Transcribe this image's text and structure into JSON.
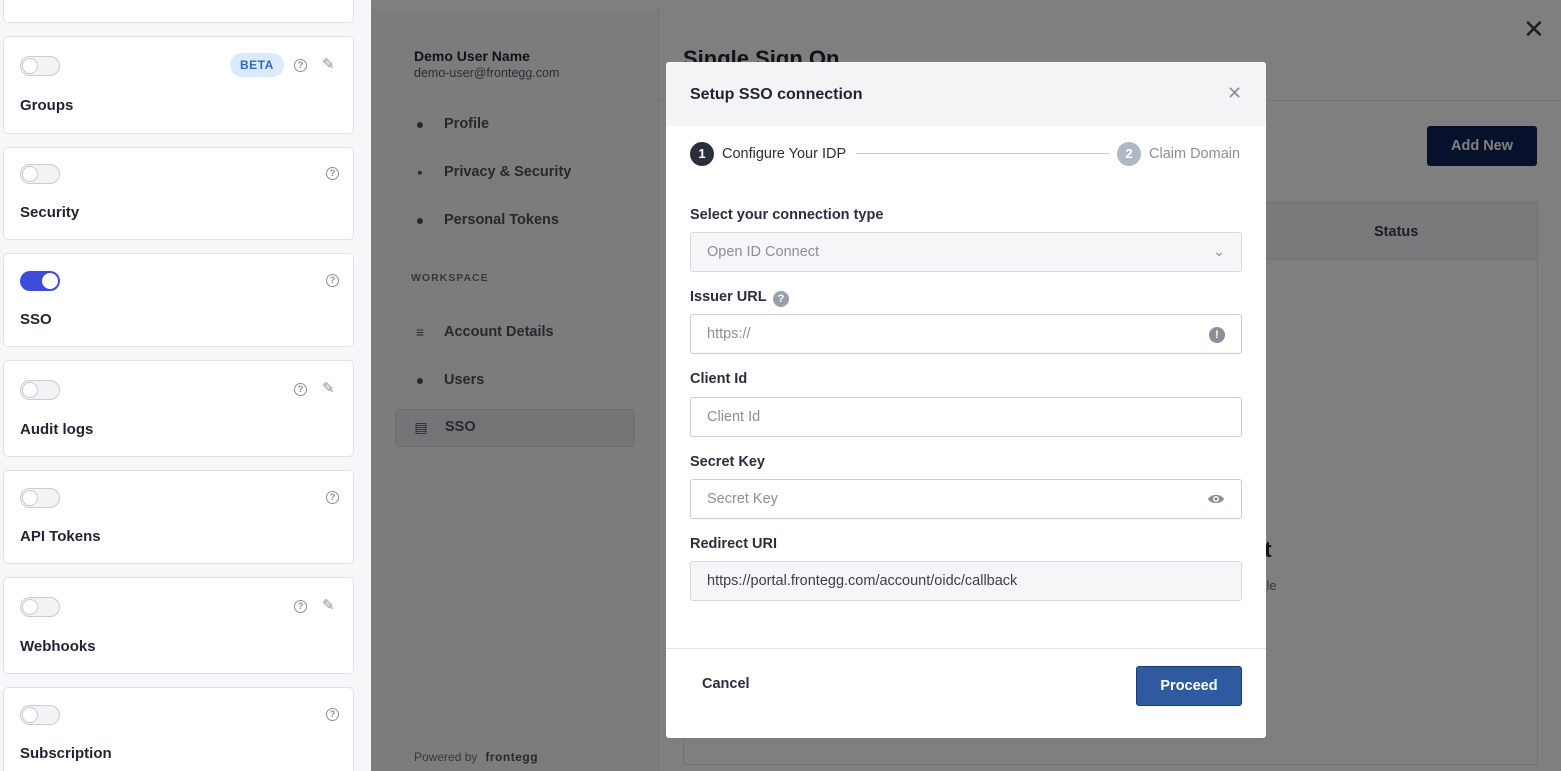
{
  "features": [
    {
      "title": "Groups",
      "enabled": false,
      "badge": "BETA",
      "help": true,
      "edit": true
    },
    {
      "title": "Security",
      "enabled": false,
      "help": true,
      "edit": false
    },
    {
      "title": "SSO",
      "enabled": true,
      "help": true,
      "edit": false
    },
    {
      "title": "Audit logs",
      "enabled": false,
      "help": true,
      "edit": true
    },
    {
      "title": "API Tokens",
      "enabled": false,
      "help": true,
      "edit": false
    },
    {
      "title": "Webhooks",
      "enabled": false,
      "help": true,
      "edit": true
    },
    {
      "title": "Subscription",
      "enabled": false,
      "help": true,
      "edit": false
    }
  ],
  "portal": {
    "user_name": "Demo User Name",
    "user_email": "demo-user@frontegg.com",
    "nav": [
      {
        "label": "Profile",
        "icon": "user-icon"
      },
      {
        "label": "Privacy & Security",
        "icon": "lock-icon"
      },
      {
        "label": "Personal Tokens",
        "icon": "user-key-icon"
      }
    ],
    "workspace_heading": "WORKSPACE",
    "workspace_nav": [
      {
        "label": "Account Details",
        "icon": "sliders-icon"
      },
      {
        "label": "Users",
        "icon": "users-icon"
      },
      {
        "label": "SSO",
        "icon": "id-card-icon",
        "active": true
      }
    ],
    "powered_by": "Powered by",
    "brand": "frontegg",
    "page_title": "Single Sign On",
    "add_new": "Add New",
    "table_status_header": "Status",
    "empty_title_fragment": "et",
    "empty_sub_fragment": "able"
  },
  "modal": {
    "title": "Setup SSO connection",
    "steps": [
      {
        "number": "1",
        "label": "Configure Your IDP"
      },
      {
        "number": "2",
        "label": "Claim Domain"
      }
    ],
    "connection_type_label": "Select your connection type",
    "connection_type_value": "Open ID Connect",
    "issuer_url_label": "Issuer URL",
    "issuer_url_placeholder": "https://",
    "client_id_label": "Client Id",
    "client_id_placeholder": "Client Id",
    "secret_key_label": "Secret Key",
    "secret_key_placeholder": "Secret Key",
    "redirect_uri_label": "Redirect URI",
    "redirect_uri_value": "https://portal.frontegg.com/account/oidc/callback",
    "cancel": "Cancel",
    "proceed": "Proceed"
  }
}
